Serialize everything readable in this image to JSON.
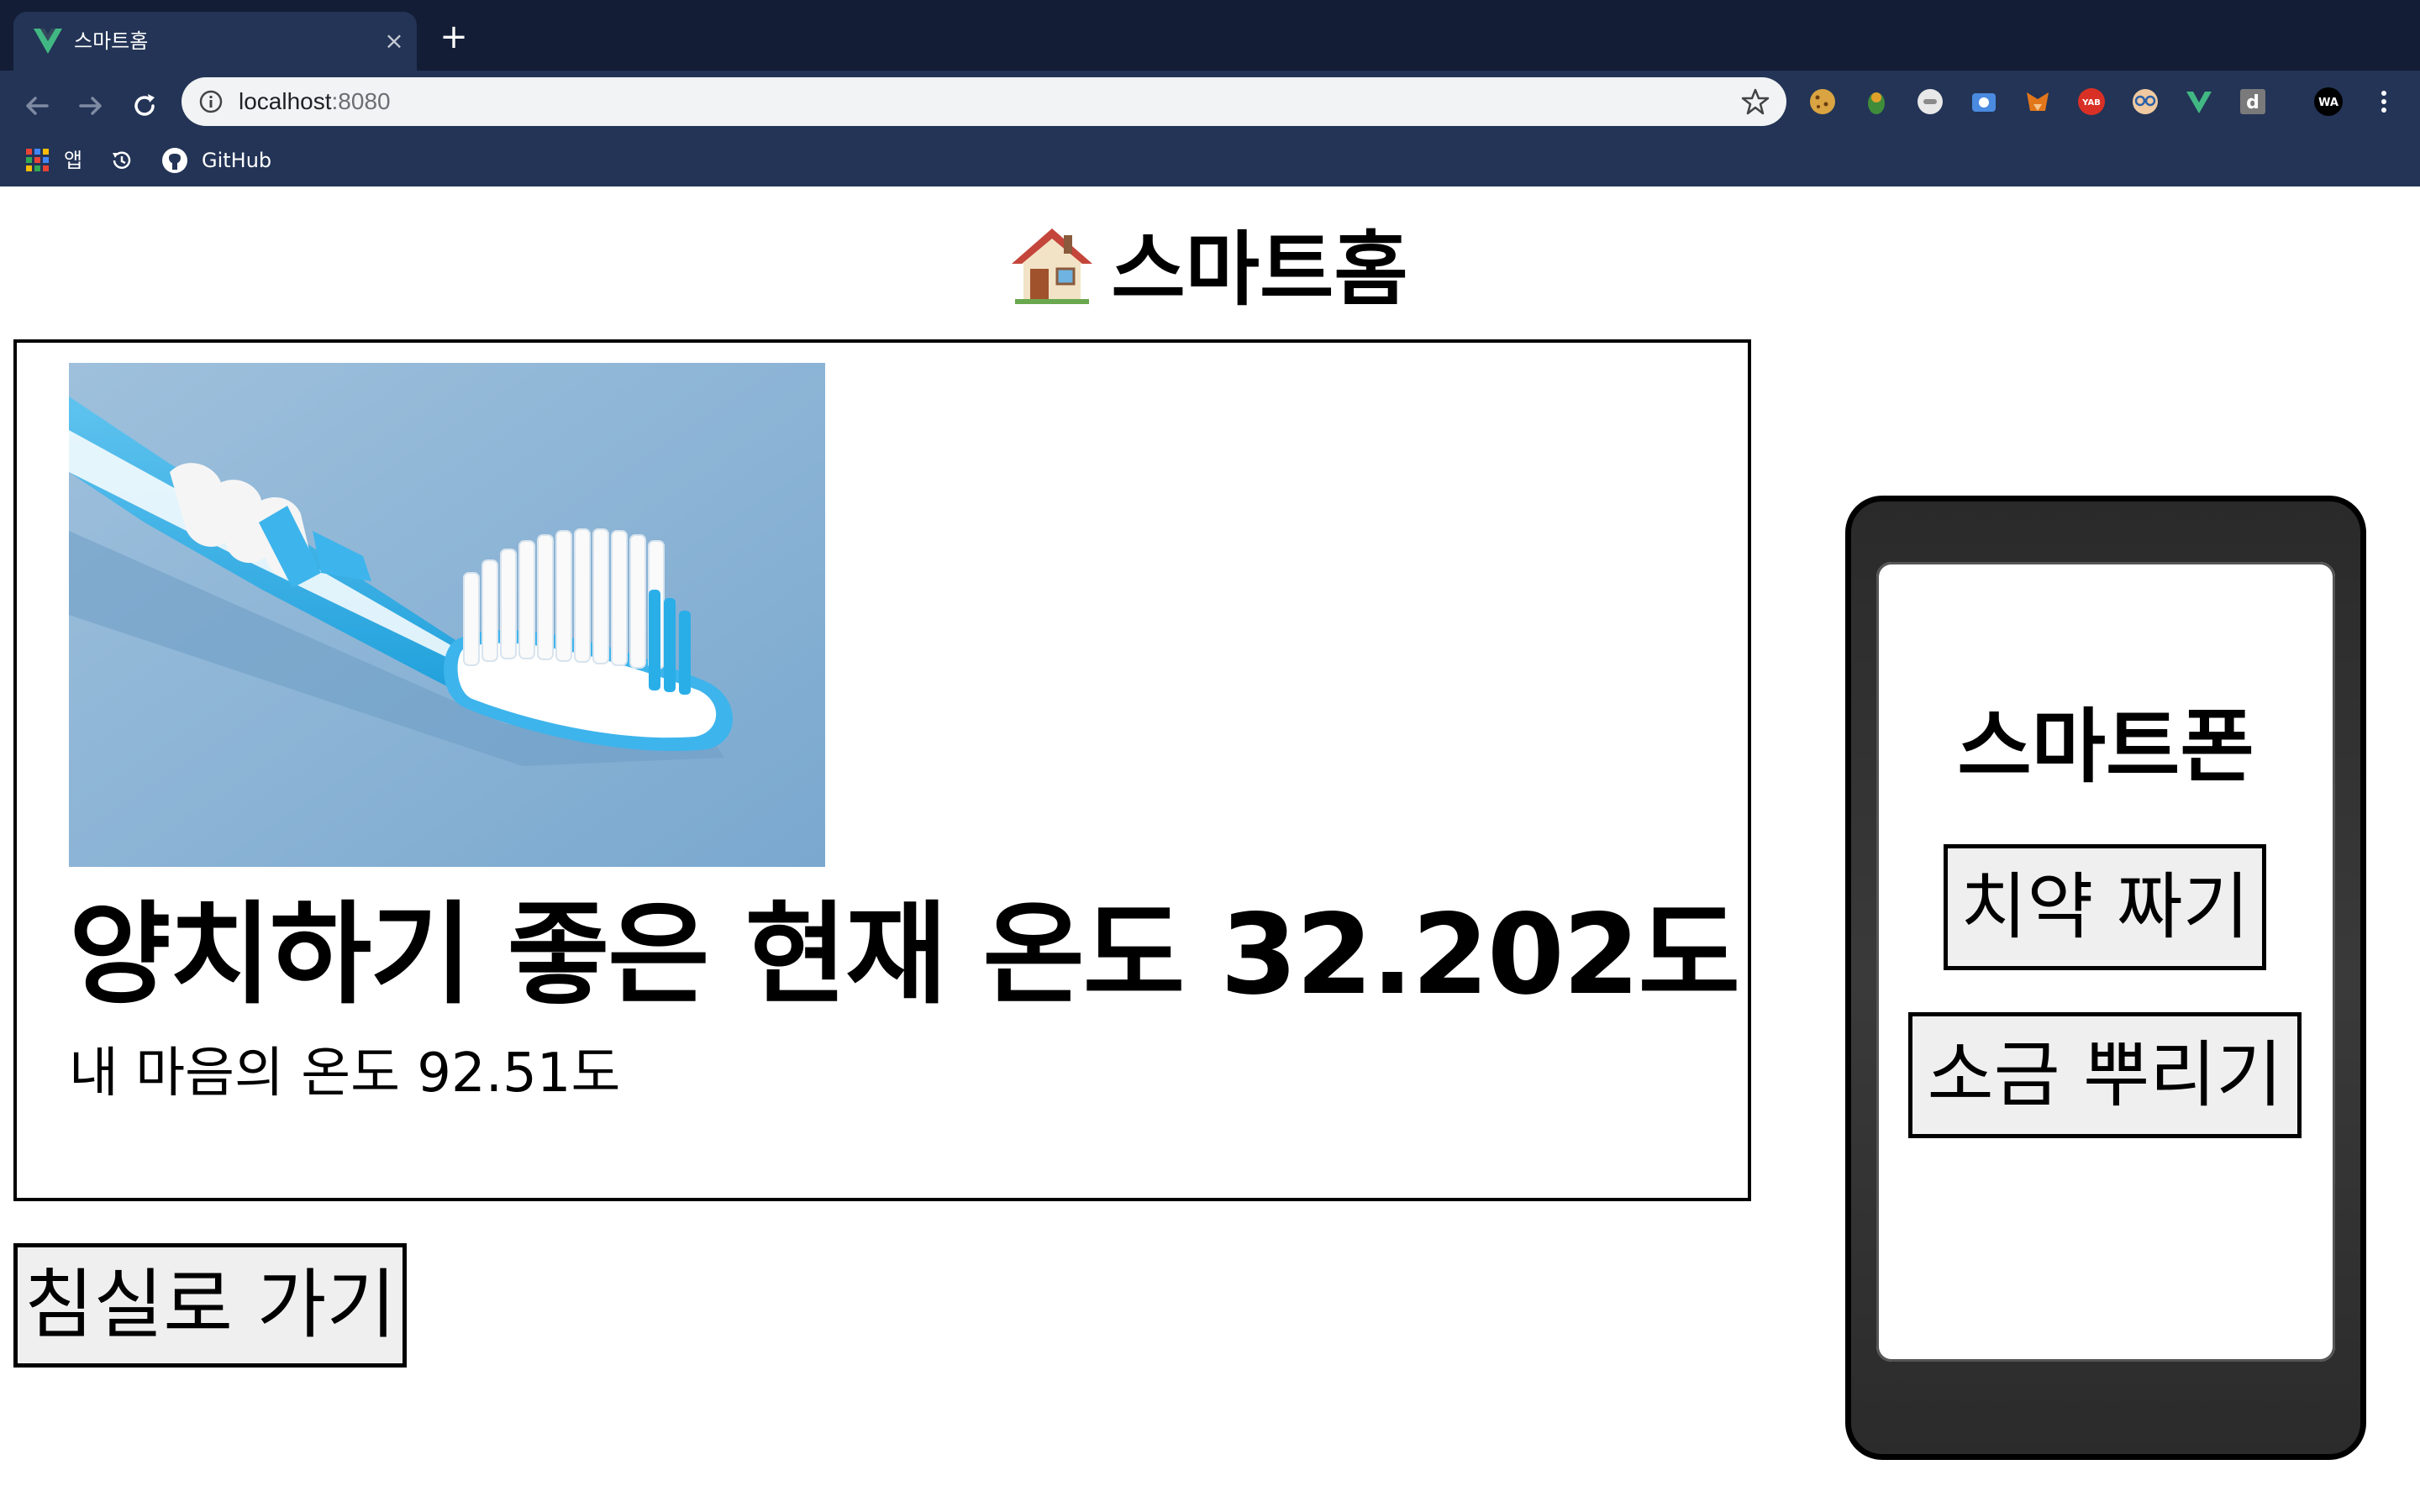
{
  "browser": {
    "tab_title": "스마트홈",
    "tab_close": "×",
    "new_tab": "+",
    "url_host": "localhost",
    "url_port": ":8080",
    "bookmarks": [
      {
        "label": "앱",
        "icon": "apps-grid-icon"
      },
      {
        "label": "",
        "icon": "history-icon"
      },
      {
        "label": "GitHub",
        "icon": "github-icon"
      }
    ],
    "extensions": [
      "cookie-icon",
      "leaf-extension-icon",
      "circle-extension-icon",
      "camera-extension-icon",
      "fox-extension-icon",
      "yab-extension-icon",
      "glasses-extension-icon",
      "vue-devtools-icon",
      "d-extension-icon",
      "wa-extension-icon"
    ],
    "extension_labels": {
      "yab": "YAB",
      "d": "d",
      "wa": "WA"
    }
  },
  "page": {
    "title": "스마트홈",
    "title_icon": "house-icon",
    "room": {
      "image": "toothbrush-image",
      "heading": "양치하기 좋은 현재 온도 32.202도",
      "subheading": "내 마음의 온도 92.51도"
    },
    "go_button_label": "침실로 가기"
  },
  "phone": {
    "title": "스마트폰",
    "buttons": [
      {
        "label": "치약 짜기"
      },
      {
        "label": "소금 뿌리기"
      }
    ]
  },
  "colors": {
    "tabbar_bg": "#131d36",
    "toolbar_bg": "#233456",
    "omnibox_bg": "#f1f3f4",
    "vue_green": "#41b883",
    "button_bg": "#efefef"
  }
}
